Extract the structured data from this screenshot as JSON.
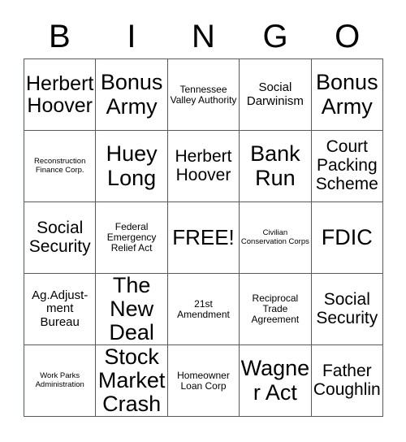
{
  "card": {
    "title_letters": [
      "B",
      "I",
      "N",
      "G",
      "O"
    ],
    "grid_size": "5x5",
    "background_color": "#ffffff",
    "text_color": "#000000",
    "border_color": "#555a5e",
    "free_space_label": "FREE!"
  },
  "rows": [
    {
      "cells": [
        {
          "text": "Herbert Hoover",
          "size": "lg"
        },
        {
          "text": "Bonus Army",
          "size": "xl"
        },
        {
          "text": "Tennessee Valley Authority",
          "size": "xs"
        },
        {
          "text": "Social Darwinism",
          "size": "sm"
        },
        {
          "text": "Bonus Army",
          "size": "xl"
        }
      ]
    },
    {
      "cells": [
        {
          "text": "Reconstruction Finance Corp.",
          "size": "xxs"
        },
        {
          "text": "Huey Long",
          "size": "xl"
        },
        {
          "text": "Herbert Hoover",
          "size": "md"
        },
        {
          "text": "Bank Run",
          "size": "xl"
        },
        {
          "text": "Court Packing Scheme",
          "size": "md"
        }
      ]
    },
    {
      "cells": [
        {
          "text": "Social Security",
          "size": "md"
        },
        {
          "text": "Federal Emergency Relief Act",
          "size": "xs"
        },
        {
          "text": "FREE!",
          "size": "free"
        },
        {
          "text": "Civilian Conservation Corps",
          "size": "xxs"
        },
        {
          "text": "FDIC",
          "size": "xl"
        }
      ]
    },
    {
      "cells": [
        {
          "text": "Ag.Adjust-ment Bureau",
          "size": "sm"
        },
        {
          "text": "The New Deal",
          "size": "xl"
        },
        {
          "text": "21st Amendment",
          "size": "xs"
        },
        {
          "text": "Reciprocal Trade Agreement",
          "size": "xs"
        },
        {
          "text": "Social Security",
          "size": "md"
        }
      ]
    },
    {
      "cells": [
        {
          "text": "Work Parks Administration",
          "size": "xxs"
        },
        {
          "text": "Stock Market Crash",
          "size": "xl"
        },
        {
          "text": "Homeowner Loan Corp",
          "size": "xs"
        },
        {
          "text": "Wagner Act",
          "size": "xl"
        },
        {
          "text": "Father Coughlin",
          "size": "md"
        }
      ]
    }
  ]
}
